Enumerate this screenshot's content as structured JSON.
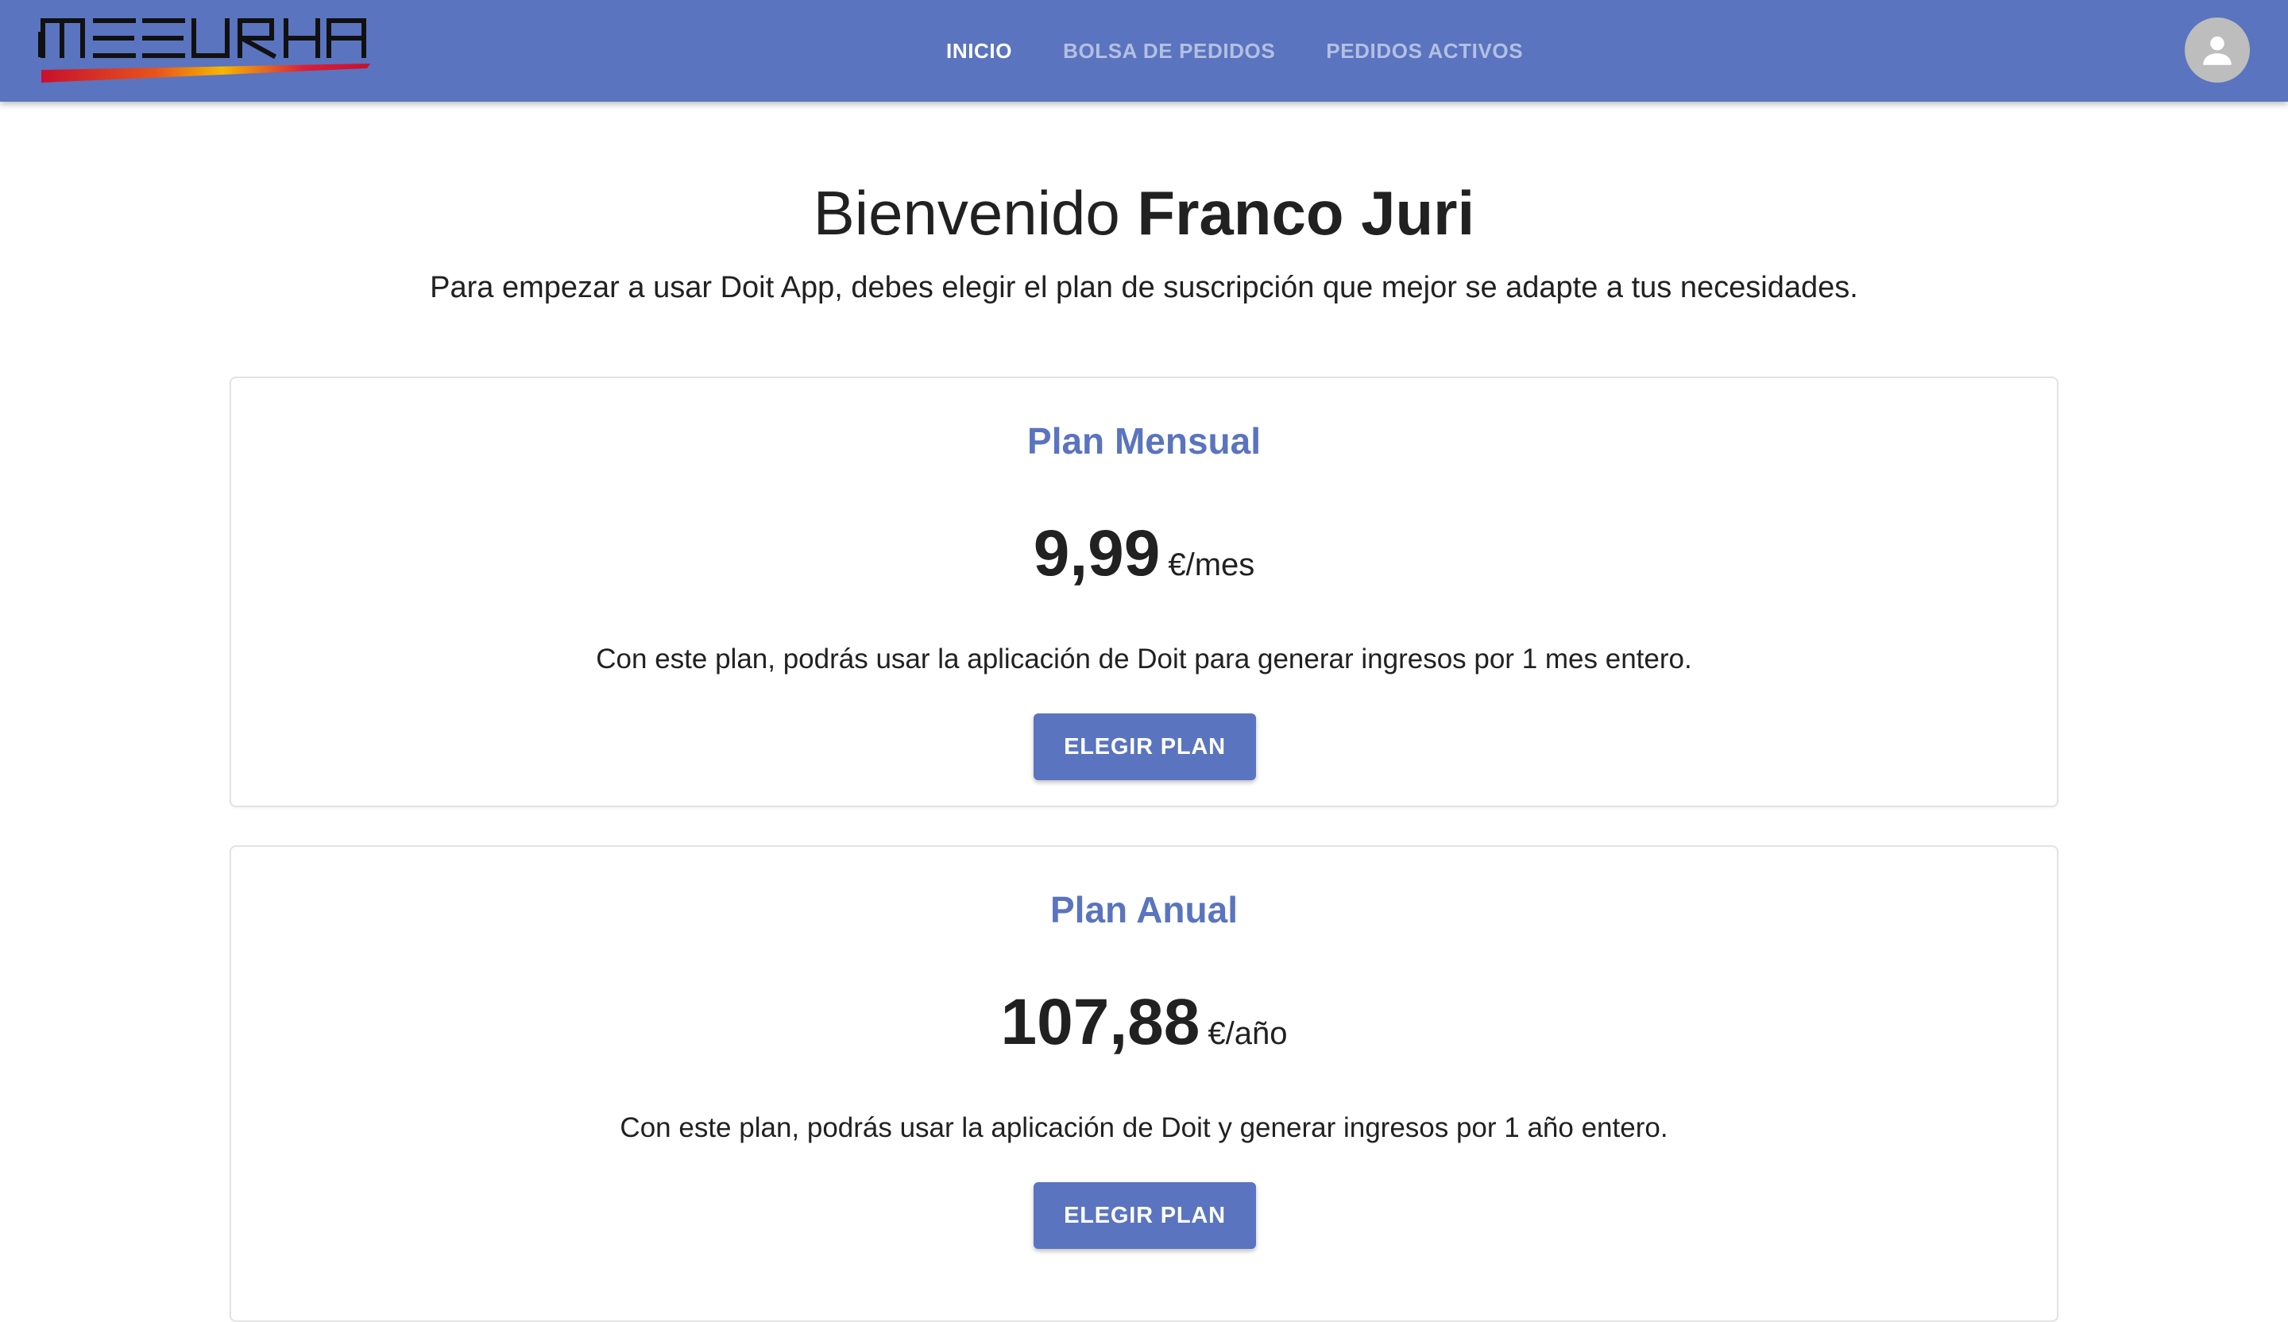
{
  "header": {
    "logo_text": "MEEURHA",
    "nav": [
      {
        "label": "INICIO",
        "active": true
      },
      {
        "label": "BOLSA DE PEDIDOS",
        "active": false
      },
      {
        "label": "PEDIDOS ACTIVOS",
        "active": false
      }
    ],
    "avatar_icon": "account-circle-icon"
  },
  "welcome": {
    "greeting": "Bienvenido",
    "user_name": "Franco Juri",
    "subtitle": "Para empezar a usar Doit App, debes elegir el plan de suscripción que mejor se adapte a tus necesidades."
  },
  "plans": [
    {
      "title": "Plan Mensual",
      "price": "9,99",
      "unit": "€/mes",
      "description": "Con este plan, podrás usar la aplicación de Doit para generar ingresos por 1 mes entero.",
      "button_label": "ELEGIR PLAN"
    },
    {
      "title": "Plan Anual",
      "price": "107,88",
      "unit": "€/año",
      "description": "Con este plan, podrás usar la aplicación de Doit y generar ingresos por 1 año entero.",
      "button_label": "ELEGIR PLAN"
    }
  ],
  "colors": {
    "primary": "#5a74bf",
    "text": "#212121",
    "avatar_bg": "#bdbdbd"
  }
}
